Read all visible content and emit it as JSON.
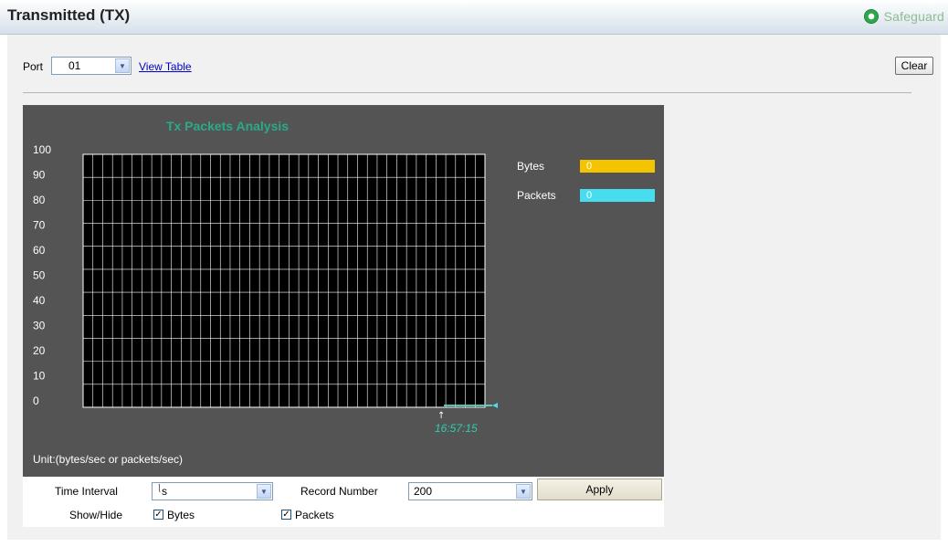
{
  "header": {
    "title": "Transmitted (TX)",
    "safeguard_label": "Safeguard",
    "safeguard_color": "#2ca84a"
  },
  "toolbar": {
    "port_label": "Port",
    "port_value": "01",
    "view_table_label": "View Table",
    "clear_label": "Clear"
  },
  "chart_data": {
    "type": "line",
    "title": "Tx Packets Analysis",
    "yticks": [
      100,
      90,
      80,
      70,
      60,
      50,
      40,
      30,
      20,
      10,
      0
    ],
    "ylim": [
      0,
      100
    ],
    "grid": true,
    "x": [
      "16:57:15"
    ],
    "series": [
      {
        "name": "Bytes",
        "values": [
          0
        ],
        "color": "#f5c400"
      },
      {
        "name": "Packets",
        "values": [
          0
        ],
        "color": "#48ddee"
      }
    ],
    "legend_placement": "right",
    "unit_note": "Unit:(bytes/sec or packets/sec)",
    "background": "#545454",
    "title_color": "#2aaa8a"
  },
  "controls": {
    "time_interval_label": "Time Interval",
    "time_interval_value": "s",
    "record_number_label": "Record Number",
    "record_number_value": "200",
    "apply_label": "Apply",
    "show_hide_label": "Show/Hide",
    "bytes_checkbox_label": "Bytes",
    "packets_checkbox_label": "Packets",
    "bytes_checked": true,
    "packets_checked": true
  }
}
